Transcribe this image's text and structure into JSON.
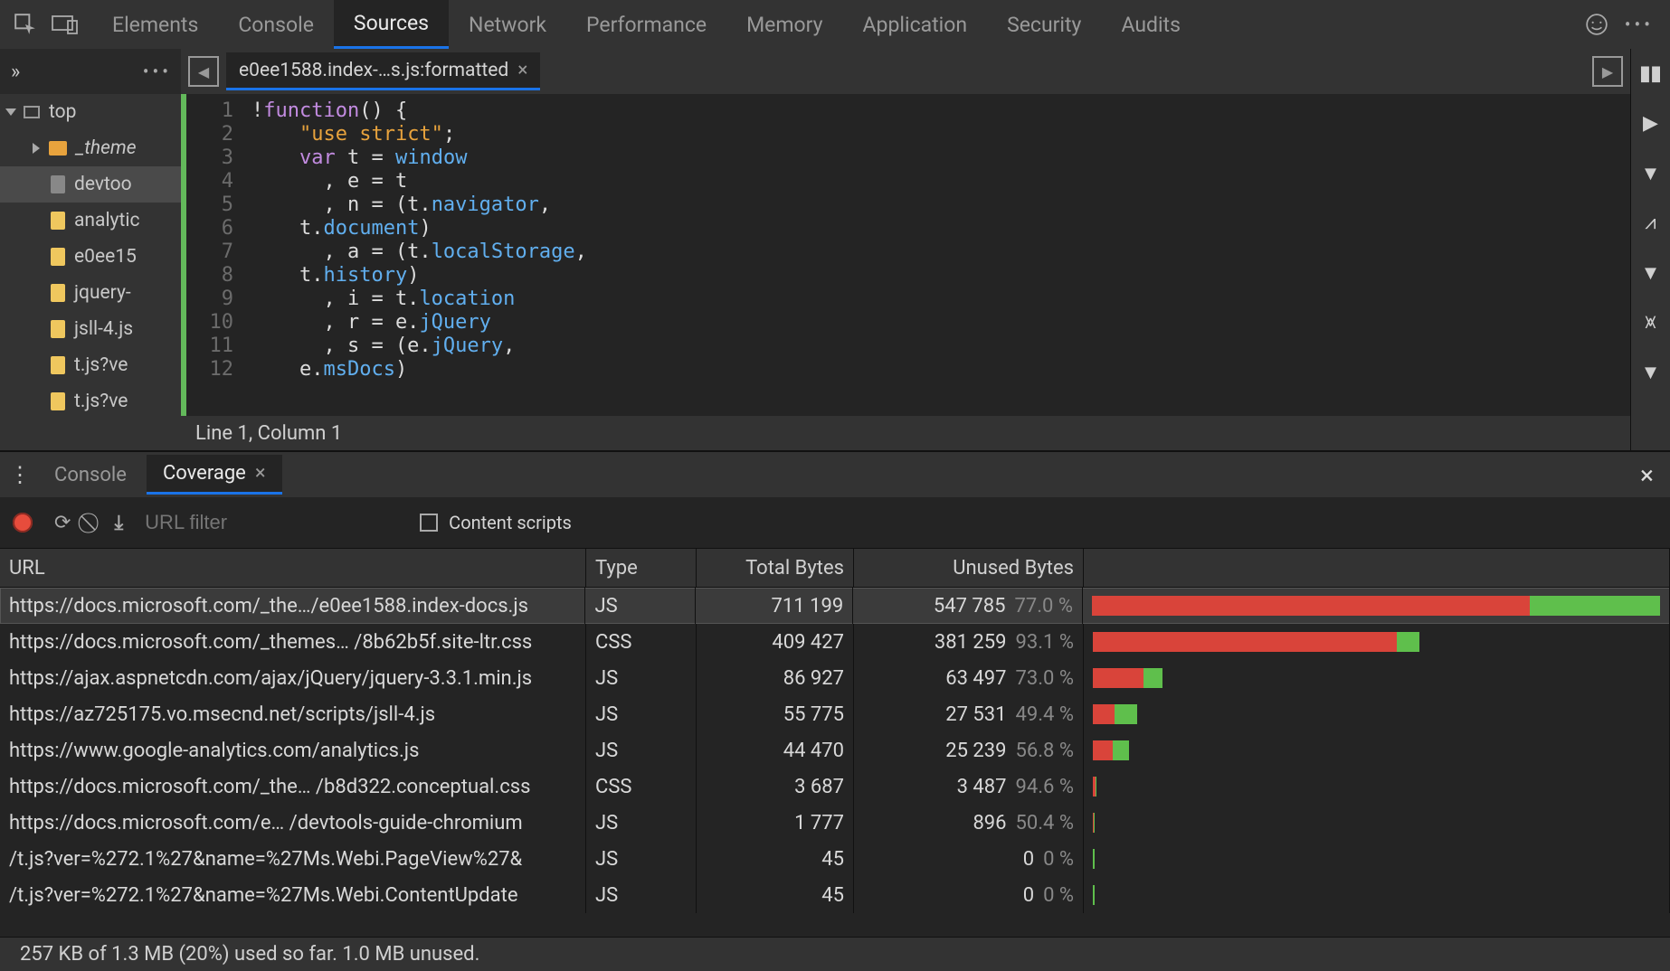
{
  "top_tabs": [
    "Elements",
    "Console",
    "Sources",
    "Network",
    "Performance",
    "Memory",
    "Application",
    "Security",
    "Audits"
  ],
  "top_active": 2,
  "sidebar": {
    "root": "top",
    "items": [
      {
        "label": "_theme",
        "icon": "folder",
        "indent": 1,
        "italic": true
      },
      {
        "label": "devtoo",
        "icon": "plain",
        "indent": 2,
        "selected": true
      },
      {
        "label": "analytic",
        "icon": "js",
        "indent": 2
      },
      {
        "label": "e0ee15",
        "icon": "js",
        "indent": 2
      },
      {
        "label": "jquery-",
        "icon": "js",
        "indent": 2
      },
      {
        "label": "jsll-4.js",
        "icon": "js",
        "indent": 2
      },
      {
        "label": "t.js?ve",
        "icon": "js",
        "indent": 2
      },
      {
        "label": "t.js?ve",
        "icon": "js",
        "indent": 2
      }
    ]
  },
  "editor": {
    "tab_label": "e0ee1588.index-…s.js:formatted",
    "status": "Line 1, Column 1",
    "lines": [
      "!function() {",
      "    \"use strict\";",
      "    var t = window",
      "      , e = t",
      "      , n = (t.navigator,",
      "    t.document)",
      "      , a = (t.localStorage,",
      "    t.history)",
      "      , i = t.location",
      "      , r = e.jQuery",
      "      , s = (e.jQuery,",
      "    e.msDocs)"
    ]
  },
  "drawer": {
    "tabs": [
      "Console",
      "Coverage"
    ],
    "active": 1,
    "filter_placeholder": "URL filter",
    "content_scripts_label": "Content scripts",
    "columns": [
      "URL",
      "Type",
      "Total Bytes",
      "Unused Bytes"
    ],
    "rows": [
      {
        "url": "https://docs.microsoft.com/_the…/e0ee1588.index-docs.js",
        "type": "JS",
        "total": "711 199",
        "unused": "547 785",
        "pct": "77.0 %",
        "bar_scale": 1.0,
        "selected": true
      },
      {
        "url": "https://docs.microsoft.com/_themes… /8b62b5f.site-ltr.css",
        "type": "CSS",
        "total": "409 427",
        "unused": "381 259",
        "pct": "93.1 %",
        "bar_scale": 0.575
      },
      {
        "url": "https://ajax.aspnetcdn.com/ajax/jQuery/jquery-3.3.1.min.js",
        "type": "JS",
        "total": "86 927",
        "unused": "63 497",
        "pct": "73.0 %",
        "bar_scale": 0.122
      },
      {
        "url": "https://az725175.vo.msecnd.net/scripts/jsll-4.js",
        "type": "JS",
        "total": "55 775",
        "unused": "27 531",
        "pct": "49.4 %",
        "bar_scale": 0.078
      },
      {
        "url": "https://www.google-analytics.com/analytics.js",
        "type": "JS",
        "total": "44 470",
        "unused": "25 239",
        "pct": "56.8 %",
        "bar_scale": 0.063
      },
      {
        "url": "https://docs.microsoft.com/_the… /b8d322.conceptual.css",
        "type": "CSS",
        "total": "3 687",
        "unused": "3 487",
        "pct": "94.6 %",
        "bar_scale": 0.005
      },
      {
        "url": "https://docs.microsoft.com/e…  /devtools-guide-chromium",
        "type": "JS",
        "total": "1 777",
        "unused": "896",
        "pct": "50.4 %",
        "bar_scale": 0.003
      },
      {
        "url": "/t.js?ver=%272.1%27&name=%27Ms.Webi.PageView%27&",
        "type": "JS",
        "total": "45",
        "unused": "0",
        "pct": "0 %",
        "bar_scale": 0.0
      },
      {
        "url": "/t.js?ver=%272.1%27&name=%27Ms.Webi.ContentUpdate",
        "type": "JS",
        "total": "45",
        "unused": "0",
        "pct": "0 %",
        "bar_scale": 0.0
      }
    ],
    "status": "257 KB of 1.3 MB (20%) used so far. 1.0 MB unused."
  }
}
